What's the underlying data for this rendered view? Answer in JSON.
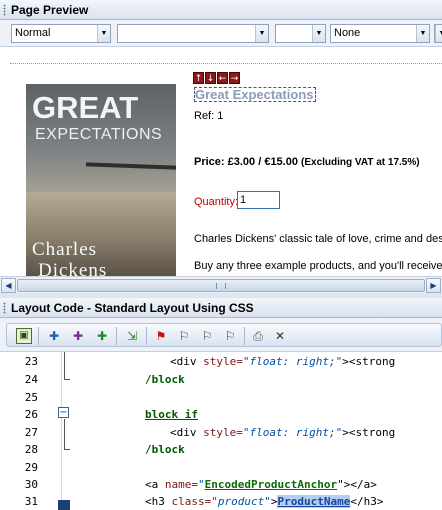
{
  "preview_panel": {
    "title": "Page Preview",
    "format_select": "Normal",
    "font_select": "",
    "size_select": "",
    "style_select": "None"
  },
  "product": {
    "book_title_line1": "GREAT",
    "book_title_line2": "EXPECTATIONS",
    "book_author_line1": "Charles",
    "book_author_line2": "Dickens",
    "arrows": [
      "↑",
      "↓",
      "←",
      "→"
    ],
    "name": "Great Expectations",
    "ref": "Ref: 1",
    "price": "Price: £3.00 / €15.00",
    "vat_note": "(Excluding VAT at 17.5%)",
    "quantity_label": "Quantity:",
    "quantity_value": "1",
    "description": "Charles Dickens' classic tale of love, crime and dest",
    "offer": "Buy any three example products, and you'll receive"
  },
  "layout_panel": {
    "title": "Layout Code  - Standard Layout Using CSS"
  },
  "toolbar_icons": [
    "design-view-icon",
    "add-icon",
    "add-alt-icon",
    "add-green-icon",
    "insert-field-icon",
    "flag-red-icon",
    "flag-next-icon",
    "flag-prev-icon",
    "flag-clear-icon",
    "print-icon",
    "tools-icon"
  ],
  "code_lines": [
    {
      "num": "23",
      "parts": {
        "a": "<div ",
        "b": "style=",
        "c": "\"float: right;\"",
        "d": "><strong"
      }
    },
    {
      "num": "24",
      "text": "/block"
    },
    {
      "num": "25",
      "text": ""
    },
    {
      "num": "26",
      "text": "block if"
    },
    {
      "num": "27",
      "parts": {
        "a": "<div ",
        "b": "style=",
        "c": "\"float: right;\"",
        "d": "><strong"
      }
    },
    {
      "num": "28",
      "text": "/block"
    },
    {
      "num": "29",
      "text": ""
    },
    {
      "num": "30",
      "parts": {
        "a": "<a ",
        "b": "name=",
        "c": "\"",
        "d": "EncodedProductAnchor",
        "e": "\"></a>"
      }
    },
    {
      "num": "31",
      "parts": {
        "a": "<h3 ",
        "b": "class=",
        "c": "\"product\"",
        "d": ">",
        "e": "ProductName",
        "f": "</h3>"
      }
    }
  ],
  "colors": {
    "panel_header_bg": "#d8e2ef",
    "product_name": "#8b9bb8",
    "quantity_label": "#c00000",
    "keyword_green": "#005a00",
    "selection": "#b5cdf0"
  }
}
